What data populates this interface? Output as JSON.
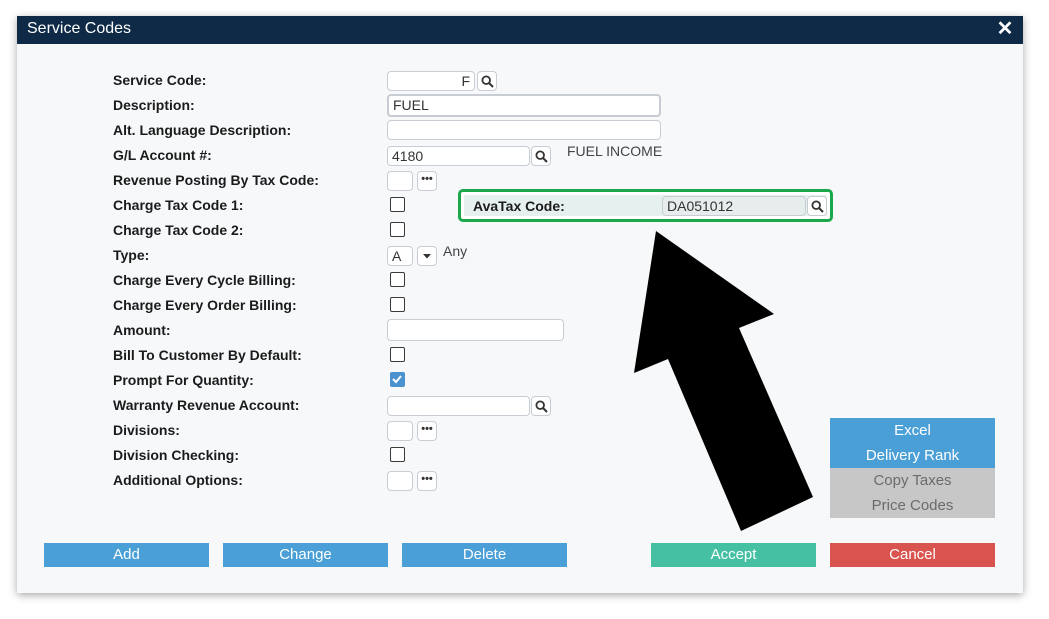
{
  "window": {
    "title": "Service Codes",
    "close_glyph": "✕"
  },
  "form": {
    "labels": {
      "service_code": "Service Code:",
      "description": "Description:",
      "alt_language_description": "Alt. Language Description:",
      "gl_account": "G/L Account #:",
      "revenue_posting_by_tax_code": "Revenue Posting By Tax Code:",
      "charge_tax_code_1": "Charge Tax Code 1:",
      "charge_tax_code_2": "Charge Tax Code 2:",
      "type": "Type:",
      "charge_every_cycle_billing": "Charge Every Cycle Billing:",
      "charge_every_order_billing": "Charge Every Order Billing:",
      "amount": "Amount:",
      "bill_to_customer_by_default": "Bill To Customer By Default:",
      "prompt_for_quantity": "Prompt For Quantity:",
      "warranty_revenue_account": "Warranty Revenue Account:",
      "divisions": "Divisions:",
      "division_checking": "Division Checking:",
      "additional_options": "Additional Options:"
    },
    "values": {
      "service_code": "F",
      "description": "FUEL",
      "alt_language_description": "",
      "gl_account": "4180",
      "gl_account_name": "FUEL INCOME",
      "type": "A",
      "type_name": "Any",
      "amount": "",
      "warranty_revenue_account": ""
    },
    "checkboxes": {
      "charge_tax_code_1": false,
      "charge_tax_code_2": false,
      "charge_every_cycle_billing": false,
      "charge_every_order_billing": false,
      "bill_to_customer_by_default": false,
      "prompt_for_quantity": true,
      "division_checking": false
    },
    "avatax": {
      "label": "AvaTax Code:",
      "value": "DA051012",
      "highlight_color": "#1aa84a"
    }
  },
  "side_buttons": {
    "excel": "Excel",
    "delivery_rank": "Delivery Rank",
    "copy_taxes": "Copy Taxes",
    "price_codes": "Price Codes"
  },
  "bottom_buttons": {
    "add": "Add",
    "change": "Change",
    "delete": "Delete",
    "accept": "Accept",
    "cancel": "Cancel"
  },
  "colors": {
    "titlebar": "#0e2a47",
    "primary_button": "#4a9fd6",
    "accept_button": "#45c0a3",
    "cancel_button": "#d9534f",
    "disabled_button": "#c7c7c7"
  }
}
